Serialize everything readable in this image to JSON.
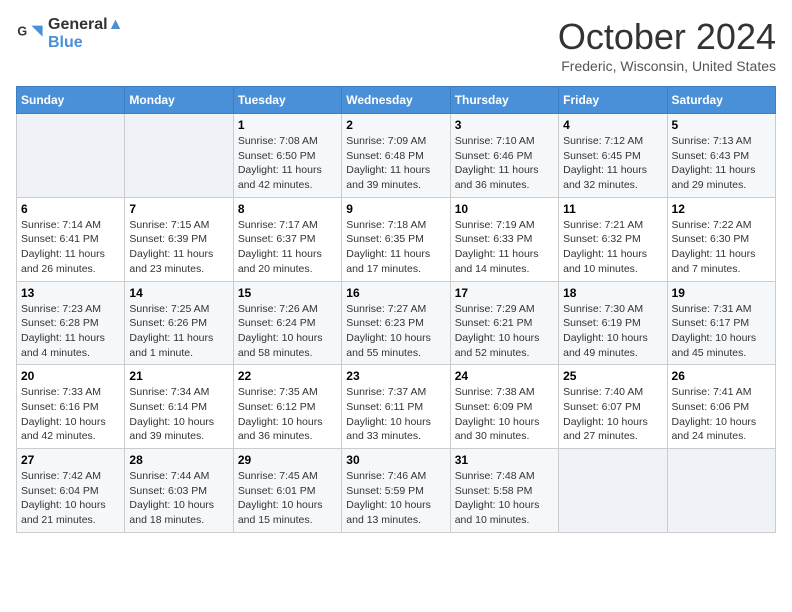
{
  "header": {
    "logo_line1": "General",
    "logo_line2": "Blue",
    "month": "October 2024",
    "location": "Frederic, Wisconsin, United States"
  },
  "days_of_week": [
    "Sunday",
    "Monday",
    "Tuesday",
    "Wednesday",
    "Thursday",
    "Friday",
    "Saturday"
  ],
  "weeks": [
    [
      {
        "num": "",
        "empty": true
      },
      {
        "num": "",
        "empty": true
      },
      {
        "num": "1",
        "sunrise": "7:08 AM",
        "sunset": "6:50 PM",
        "daylight": "11 hours and 42 minutes."
      },
      {
        "num": "2",
        "sunrise": "7:09 AM",
        "sunset": "6:48 PM",
        "daylight": "11 hours and 39 minutes."
      },
      {
        "num": "3",
        "sunrise": "7:10 AM",
        "sunset": "6:46 PM",
        "daylight": "11 hours and 36 minutes."
      },
      {
        "num": "4",
        "sunrise": "7:12 AM",
        "sunset": "6:45 PM",
        "daylight": "11 hours and 32 minutes."
      },
      {
        "num": "5",
        "sunrise": "7:13 AM",
        "sunset": "6:43 PM",
        "daylight": "11 hours and 29 minutes."
      }
    ],
    [
      {
        "num": "6",
        "sunrise": "7:14 AM",
        "sunset": "6:41 PM",
        "daylight": "11 hours and 26 minutes."
      },
      {
        "num": "7",
        "sunrise": "7:15 AM",
        "sunset": "6:39 PM",
        "daylight": "11 hours and 23 minutes."
      },
      {
        "num": "8",
        "sunrise": "7:17 AM",
        "sunset": "6:37 PM",
        "daylight": "11 hours and 20 minutes."
      },
      {
        "num": "9",
        "sunrise": "7:18 AM",
        "sunset": "6:35 PM",
        "daylight": "11 hours and 17 minutes."
      },
      {
        "num": "10",
        "sunrise": "7:19 AM",
        "sunset": "6:33 PM",
        "daylight": "11 hours and 14 minutes."
      },
      {
        "num": "11",
        "sunrise": "7:21 AM",
        "sunset": "6:32 PM",
        "daylight": "11 hours and 10 minutes."
      },
      {
        "num": "12",
        "sunrise": "7:22 AM",
        "sunset": "6:30 PM",
        "daylight": "11 hours and 7 minutes."
      }
    ],
    [
      {
        "num": "13",
        "sunrise": "7:23 AM",
        "sunset": "6:28 PM",
        "daylight": "11 hours and 4 minutes."
      },
      {
        "num": "14",
        "sunrise": "7:25 AM",
        "sunset": "6:26 PM",
        "daylight": "11 hours and 1 minute."
      },
      {
        "num": "15",
        "sunrise": "7:26 AM",
        "sunset": "6:24 PM",
        "daylight": "10 hours and 58 minutes."
      },
      {
        "num": "16",
        "sunrise": "7:27 AM",
        "sunset": "6:23 PM",
        "daylight": "10 hours and 55 minutes."
      },
      {
        "num": "17",
        "sunrise": "7:29 AM",
        "sunset": "6:21 PM",
        "daylight": "10 hours and 52 minutes."
      },
      {
        "num": "18",
        "sunrise": "7:30 AM",
        "sunset": "6:19 PM",
        "daylight": "10 hours and 49 minutes."
      },
      {
        "num": "19",
        "sunrise": "7:31 AM",
        "sunset": "6:17 PM",
        "daylight": "10 hours and 45 minutes."
      }
    ],
    [
      {
        "num": "20",
        "sunrise": "7:33 AM",
        "sunset": "6:16 PM",
        "daylight": "10 hours and 42 minutes."
      },
      {
        "num": "21",
        "sunrise": "7:34 AM",
        "sunset": "6:14 PM",
        "daylight": "10 hours and 39 minutes."
      },
      {
        "num": "22",
        "sunrise": "7:35 AM",
        "sunset": "6:12 PM",
        "daylight": "10 hours and 36 minutes."
      },
      {
        "num": "23",
        "sunrise": "7:37 AM",
        "sunset": "6:11 PM",
        "daylight": "10 hours and 33 minutes."
      },
      {
        "num": "24",
        "sunrise": "7:38 AM",
        "sunset": "6:09 PM",
        "daylight": "10 hours and 30 minutes."
      },
      {
        "num": "25",
        "sunrise": "7:40 AM",
        "sunset": "6:07 PM",
        "daylight": "10 hours and 27 minutes."
      },
      {
        "num": "26",
        "sunrise": "7:41 AM",
        "sunset": "6:06 PM",
        "daylight": "10 hours and 24 minutes."
      }
    ],
    [
      {
        "num": "27",
        "sunrise": "7:42 AM",
        "sunset": "6:04 PM",
        "daylight": "10 hours and 21 minutes."
      },
      {
        "num": "28",
        "sunrise": "7:44 AM",
        "sunset": "6:03 PM",
        "daylight": "10 hours and 18 minutes."
      },
      {
        "num": "29",
        "sunrise": "7:45 AM",
        "sunset": "6:01 PM",
        "daylight": "10 hours and 15 minutes."
      },
      {
        "num": "30",
        "sunrise": "7:46 AM",
        "sunset": "5:59 PM",
        "daylight": "10 hours and 13 minutes."
      },
      {
        "num": "31",
        "sunrise": "7:48 AM",
        "sunset": "5:58 PM",
        "daylight": "10 hours and 10 minutes."
      },
      {
        "num": "",
        "empty": true
      },
      {
        "num": "",
        "empty": true
      }
    ]
  ]
}
